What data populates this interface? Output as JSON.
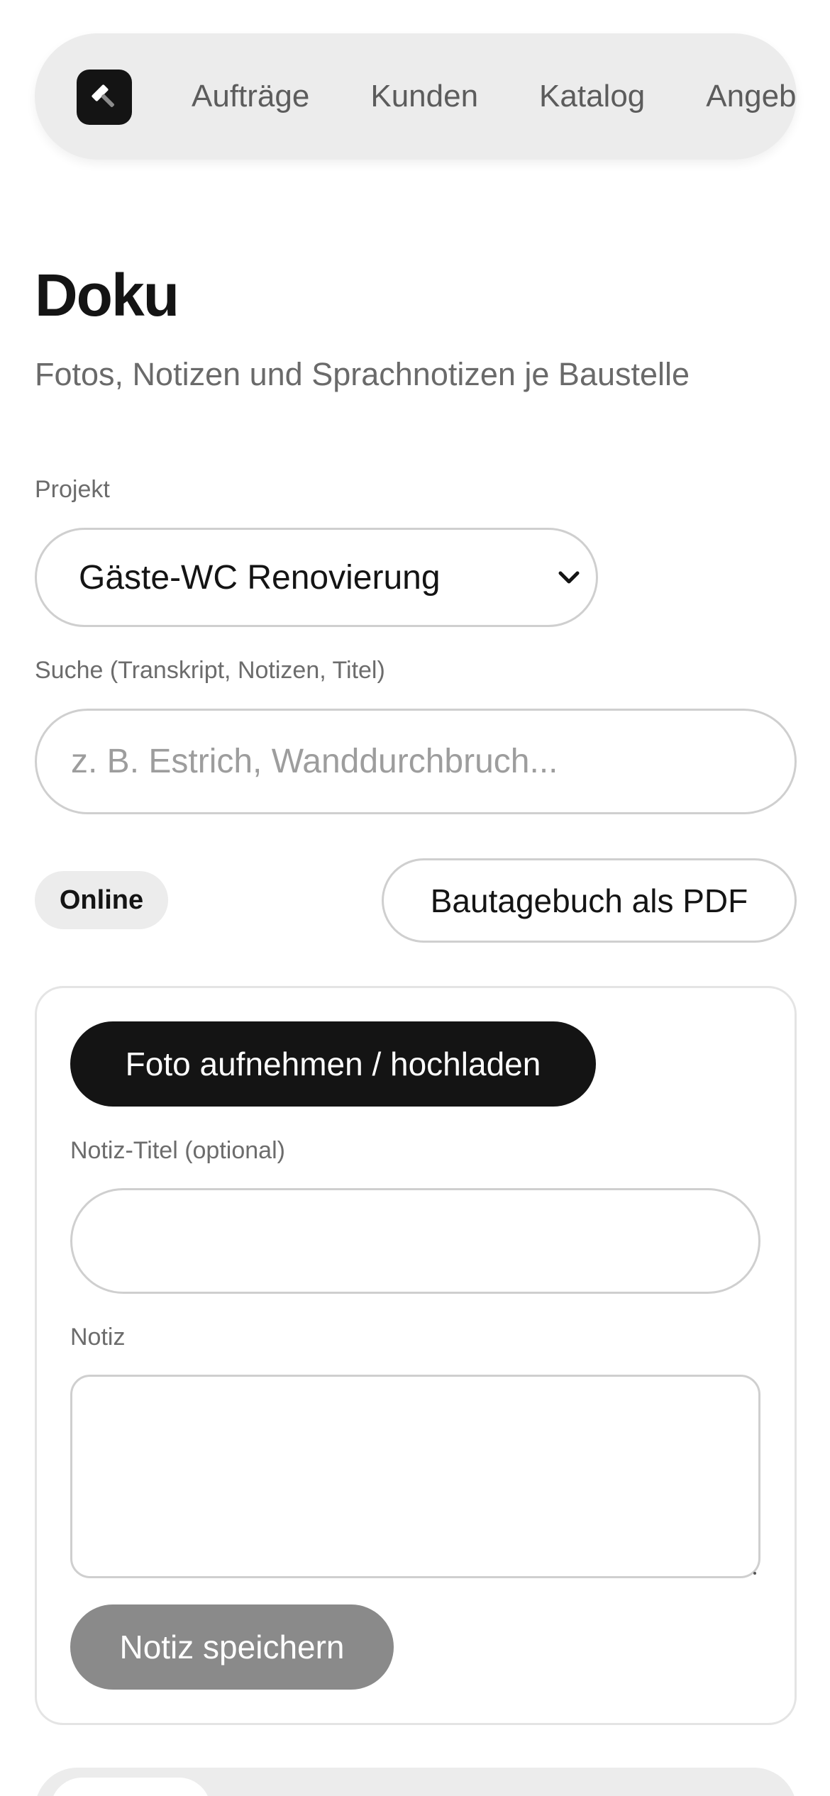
{
  "nav": {
    "logo_icon": "hammer-icon",
    "items": [
      {
        "label": "Aufträge"
      },
      {
        "label": "Kunden"
      },
      {
        "label": "Katalog"
      },
      {
        "label": "Angebote"
      }
    ]
  },
  "header": {
    "title": "Doku",
    "subtitle": "Fotos, Notizen und Sprachnotizen je Baustelle"
  },
  "project": {
    "label": "Projekt",
    "selected": "Gäste-WC Renovierung"
  },
  "search": {
    "label": "Suche (Transkript, Notizen, Titel)",
    "value": "",
    "placeholder": "z. B. Estrich, Wanddurchbruch..."
  },
  "status": {
    "label": "Online"
  },
  "actions": {
    "pdf_label": "Bautagebuch als PDF"
  },
  "card": {
    "photo_button": "Foto aufnehmen / hochladen",
    "note_title_label": "Notiz-Titel (optional)",
    "note_title_value": "",
    "note_label": "Notiz",
    "note_value": "",
    "save_button": "Notiz speichern"
  },
  "colors": {
    "primary": "#141414",
    "muted_button": "#8a8a8a",
    "surface": "#ececec",
    "border": "#cfcfcf"
  }
}
